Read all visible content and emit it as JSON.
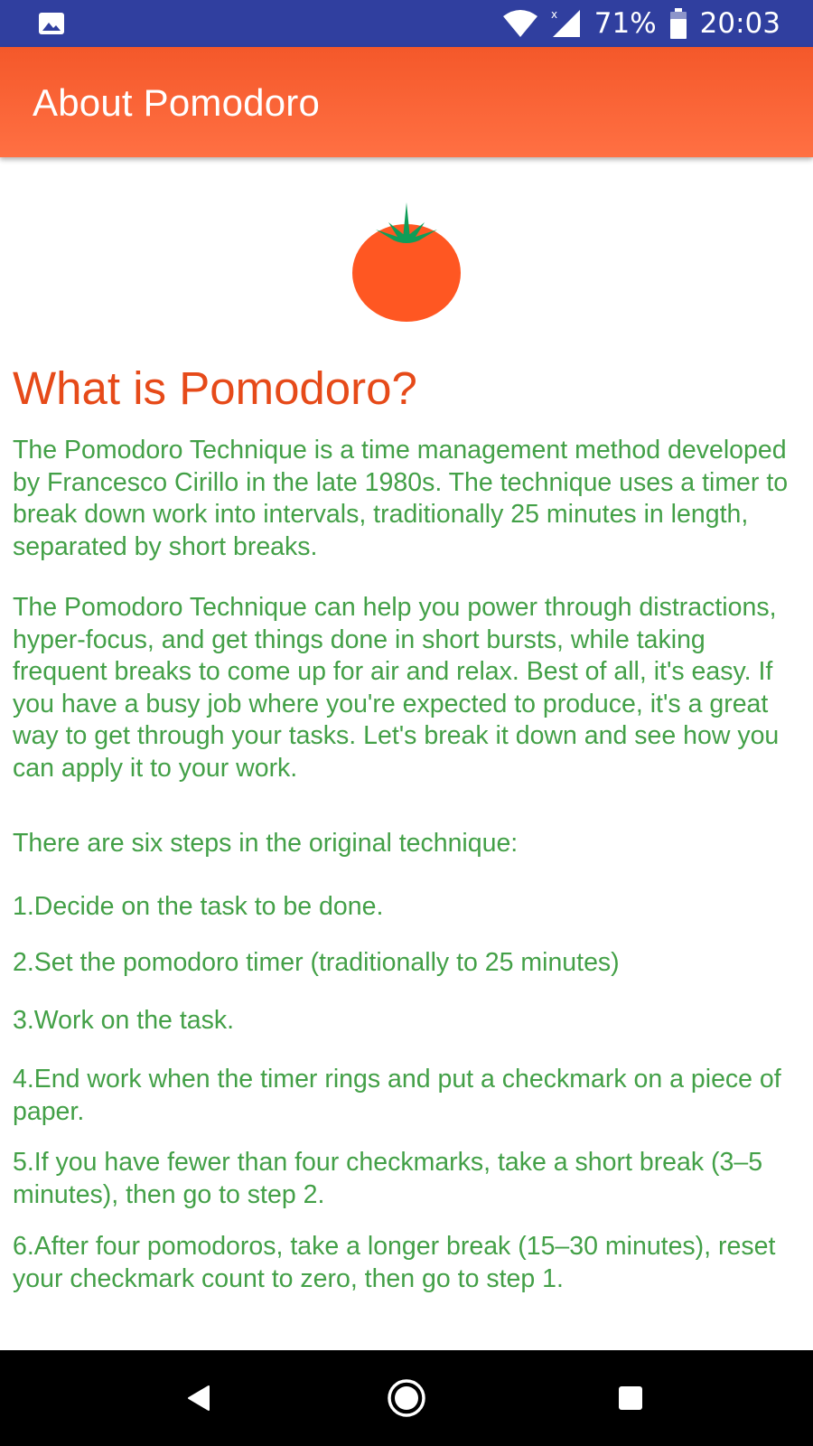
{
  "status_bar": {
    "battery": "71%",
    "time": "20:03",
    "icons": [
      "image-icon",
      "wifi-icon",
      "signal-icon",
      "battery-icon"
    ]
  },
  "app_bar": {
    "title": "About Pomodoro",
    "color": "#ff6a39"
  },
  "content": {
    "logo_icon": "tomato-icon",
    "heading": "What is Pomodoro?",
    "heading_color": "#e64a19",
    "text_color": "#43a047",
    "intro": "The Pomodoro Technique is a time management method developed by Francesco Cirillo in the late 1980s. The technique uses a timer to break down work into intervals, traditionally 25 minutes in length, separated by short breaks.",
    "benefits": "The Pomodoro Technique can help you power through distractions, hyper-focus, and get things done in short bursts, while taking frequent breaks to come up for air and relax. Best of all, it's easy. If you have a busy job where you're expected to produce, it's a great way to get through your tasks. Let's break it down and see how you can apply it to your work.",
    "steps_intro": "There are six steps in the original technique:",
    "steps": [
      "1.Decide on the task to be done.",
      "2.Set the pomodoro timer (traditionally to 25 minutes)",
      "3.Work on the task.",
      "4.End work when the timer rings and put a checkmark on a piece of paper.",
      "5.If you have fewer than four checkmarks, take a short break (3–5 minutes), then go to step 2.",
      "6.After four pomodoros, take a longer break (15–30 minutes), reset your checkmark count to zero, then go to step 1."
    ]
  },
  "nav_bar": {
    "back": "back-icon",
    "home": "home-icon",
    "recents": "recents-icon"
  }
}
